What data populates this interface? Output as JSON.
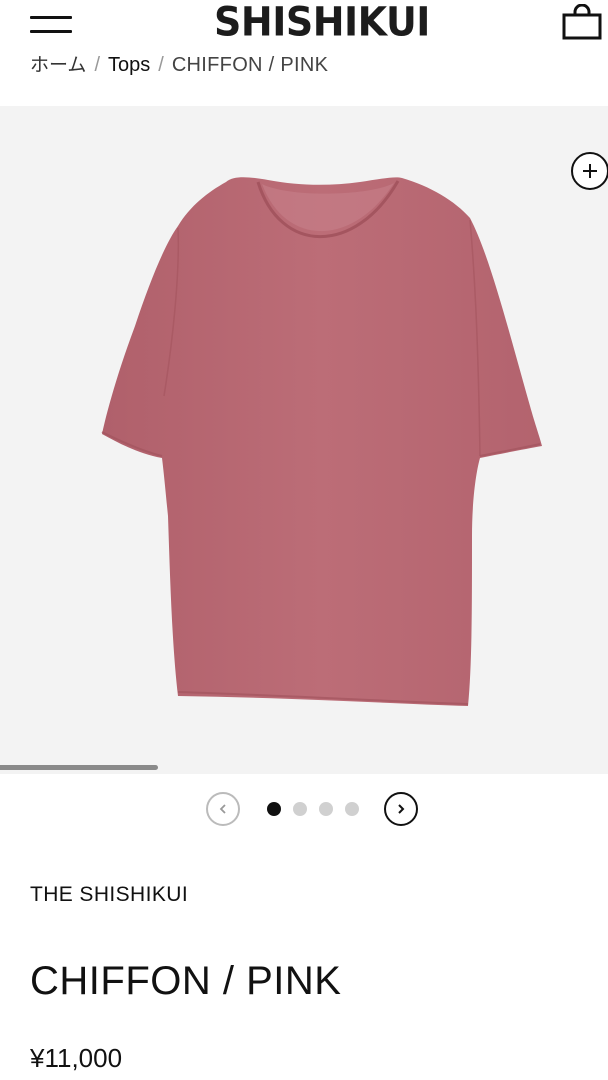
{
  "header": {
    "logo_text": "SHISHIKUI",
    "menu_icon": "hamburger-menu-icon",
    "cart_icon": "shopping-bag-icon"
  },
  "breadcrumb": {
    "home": "ホーム",
    "separator": "/",
    "category": "Tops",
    "current": "CHIFFON / PINK"
  },
  "gallery": {
    "image_subject": "pink t-shirt",
    "garment_color": "#b96a74",
    "background_color": "#f3f3f3",
    "zoom_icon": "zoom-plus-icon",
    "scroll_progress": 0.26,
    "slide_count": 4,
    "active_slide": 1,
    "prev_icon": "chevron-left-icon",
    "next_icon": "chevron-right-icon"
  },
  "product": {
    "brand": "THE SHISHIKUI",
    "title": "CHIFFON / PINK",
    "price": "¥11,000"
  }
}
